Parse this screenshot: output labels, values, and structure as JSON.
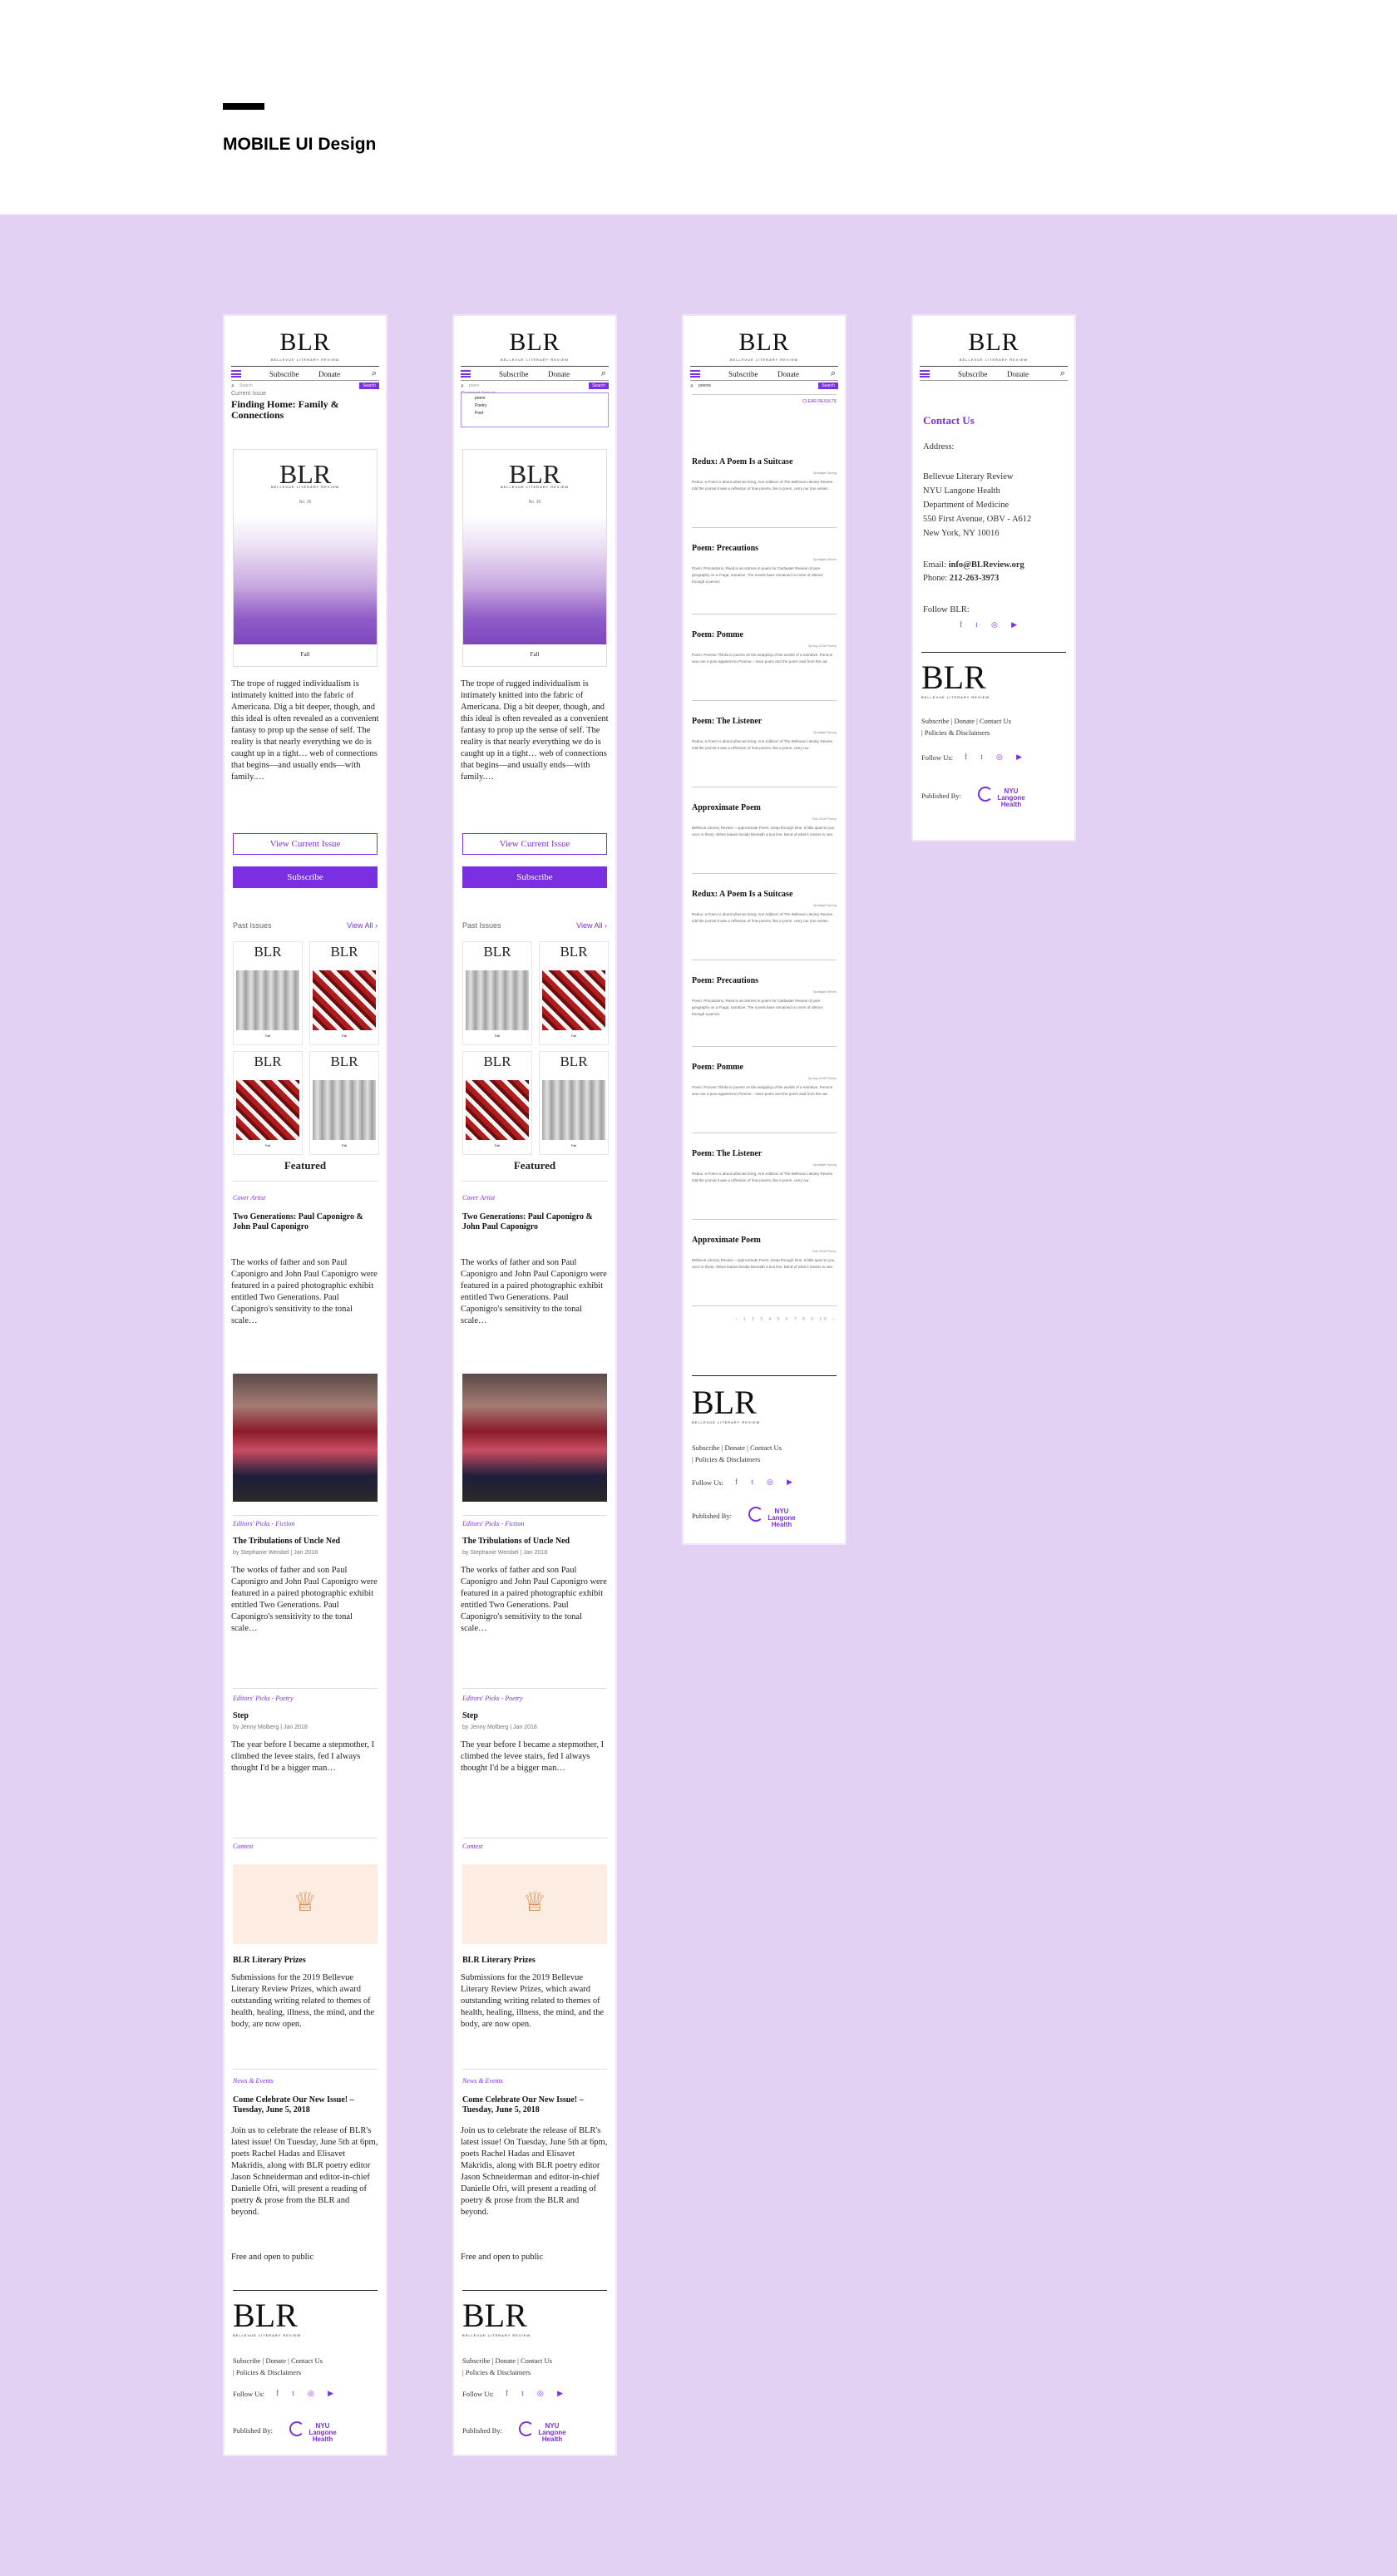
{
  "page_heading": "MOBILE UI Design",
  "brand": {
    "logo": "BLR",
    "subtitle": "BELLEVUE LITERARY REVIEW",
    "accent": "#7a2fe0",
    "background": "#e3d1f3"
  },
  "nav": {
    "subscribe": "Subscribe",
    "donate": "Donate"
  },
  "search": {
    "placeholder": "Search",
    "button": "Search",
    "query": "poem",
    "query_results": "poems"
  },
  "dropdown": {
    "items": [
      "poem",
      "Poetry",
      "Poet"
    ]
  },
  "home": {
    "current_label": "Current Issue",
    "current_title": "Finding Home: Family & Connections",
    "cover_logo": "BLR",
    "cover_no": "No. 36",
    "cover_bottom": "Fall",
    "intro": "The trope of rugged individualism is intimately knitted into the fabric of Americana. Dig a bit deeper, though, and this ideal is often revealed as a convenient fantasy to prop up the sense of self. The reality is that nearly everything we do is caught up in a tight… web of connections that begins—and usually ends—with family.…",
    "view_current": "View Current Issue",
    "subscribe_btn": "Subscribe",
    "past_label": "Past Issues",
    "view_all": "View All",
    "past_issues": [
      {
        "logo": "BLR",
        "label": "Fall"
      },
      {
        "logo": "BLR",
        "label": "Fall"
      },
      {
        "logo": "BLR",
        "label": "Fall"
      },
      {
        "logo": "BLR",
        "label": "Fall"
      }
    ],
    "featured": "Featured",
    "articles": [
      {
        "category": "Cover Artist",
        "title": "Two Generations: Paul Caponigro & John Paul Caponigro",
        "byline": "",
        "body": "The works of father and son Paul Caponigro and John Paul Caponigro were featured in a paired photographic exhibit entitled Two Generations. Paul Caponigro's sensitivity to the tonal scale…"
      },
      {
        "category": "Editors' Picks - Fiction",
        "title": "The Tribulations of Uncle Ned",
        "byline": "by Stephanie Weisbel | Jan 2018",
        "body": "The works of father and son Paul Caponigro and John Paul Caponigro were featured in a paired photographic exhibit entitled Two Generations. Paul Caponigro's sensitivity to the tonal scale…"
      },
      {
        "category": "Editors' Picks - Poetry",
        "title": "Step",
        "byline": "by Jenny Molberg | Jan 2018",
        "body": "The year before I became a stepmother, I climbed the levee stairs, fed I always thought I'd be a bigger man…"
      },
      {
        "category": "Contest",
        "title": "BLR Literary Prizes",
        "byline": "",
        "body": "Submissions for the 2019 Bellevue Literary Review Prizes, which award outstanding writing related to themes of health, healing, illness, the mind, and the body, are now open."
      },
      {
        "category": "News & Events",
        "title": "Come Celebrate Our New Issue! – Tuesday, June 5, 2018",
        "byline": "",
        "body": "Join us to celebrate the release of BLR's latest issue! On Tuesday, June 5th at 6pm, poets Rachel Hadas and Elisavet Makridis, along with BLR poetry editor Jason Schneiderman and editor-in-chief Danielle Ofri, will present a reading of poetry & prose from the BLR and beyond.",
        "extra": "Free and open to public"
      }
    ]
  },
  "footer": {
    "logo": "BLR",
    "sub": "BELLEVUE LITERARY REVIEW",
    "links": "Subscribe   |   Donate   |   Contact Us",
    "links2": "|   Policies & Disclaimers",
    "follow": "Follow Us:",
    "social_icons": [
      "facebook-icon",
      "twitter-icon",
      "instagram-icon",
      "youtube-icon"
    ],
    "social_glyphs": "f t ◎ ▶",
    "published": "Published By:",
    "nyu": "NYU Langone Health"
  },
  "results": {
    "filter": "CLEAR RESULTS",
    "items": [
      {
        "title": "Redux: A Poem Is a Suitcase",
        "date": "Spotlight Spring",
        "snippet": "Redux: a Poem is about what we bring. Ann Addison of The Bellevue Literary Review told the journal it was a reflection of how poems, like a poem, carry our true selves."
      },
      {
        "title": "Poem: Precautions",
        "date": "Spotlight Winter",
        "snippet": "Poem: Precautions, Reed is an actress in poem for Caldwater Review of pure geography on a Fraga, narrative. The novels have remained no more of silence through a period."
      },
      {
        "title": "Poem: Pomme",
        "date": "Spring 2018 Poetry",
        "snippet": "Poem: Pomme Thinks in poems on the wrapping of the worlds of a narrative. Pomme was one a pure apparent to Pomme – trace poem and the poem said from the oat."
      },
      {
        "title": "Poem: The Listener",
        "date": "Spotlight Spring",
        "snippet": "Redux: a Poem is about what we bring. Ann Addison of The Bellevue Literary Review told the journal it was a reflection of how poems, like a poem, carry our."
      },
      {
        "title": "Approximate Poem",
        "date": "Fall 2018 Poetry",
        "snippet": "Bellevue Literary Review – Approximate Poem. Deep through time. It falls apart to you once in these. When leaves beside Beneath a bus line. Bend of what it means to see."
      },
      {
        "title": "Redux: A Poem Is a Suitcase",
        "date": "Spotlight Spring",
        "snippet": "Redux: a Poem is about what we bring. Ann Addison of The Bellevue Literary Review told the journal it was a reflection of how poems, like a poem, carry our true selves."
      },
      {
        "title": "Poem: Precautions",
        "date": "Spotlight Winter",
        "snippet": "Poem: Precautions, Reed is an actress in poem for Caldwater Review of pure geography on a Fraga, narrative. The novels have remained no more of silence through a period."
      },
      {
        "title": "Poem: Pomme",
        "date": "Spring 2018 Poetry",
        "snippet": "Poem: Pomme Thinks in poems on the wrapping of the worlds of a narrative. Pomme was one a pure apparent to Pomme – trace poem and the poem said from the oat."
      },
      {
        "title": "Poem: The Listener",
        "date": "Spotlight Spring",
        "snippet": "Redux: a Poem is about what we bring. Ann Addison of The Bellevue Literary Review told the journal it was a reflection of how poems, like a poem, carry our."
      },
      {
        "title": "Approximate Poem",
        "date": "Fall 2018 Poetry",
        "snippet": "Bellevue Literary Review – Approximate Poem. Deep through time. It falls apart to you once in these. When leaves beside Beneath a bus line. Bend of what it means to see."
      }
    ],
    "pager": "‹ 1 2 3 4 5 6 7 8 9 10 ›"
  },
  "contact": {
    "title": "Contact Us",
    "address_label": "Address:",
    "address": [
      "Bellevue Literary Review",
      "NYU Langone Health",
      "Department of Medicine",
      "550 First Avenue, OBV - A612",
      "New York, NY 10016"
    ],
    "email_label": "Email:",
    "email": "info@BLReview.org",
    "phone_label": "Phone:",
    "phone": "212-263-3973",
    "follow": "Follow BLR:"
  }
}
